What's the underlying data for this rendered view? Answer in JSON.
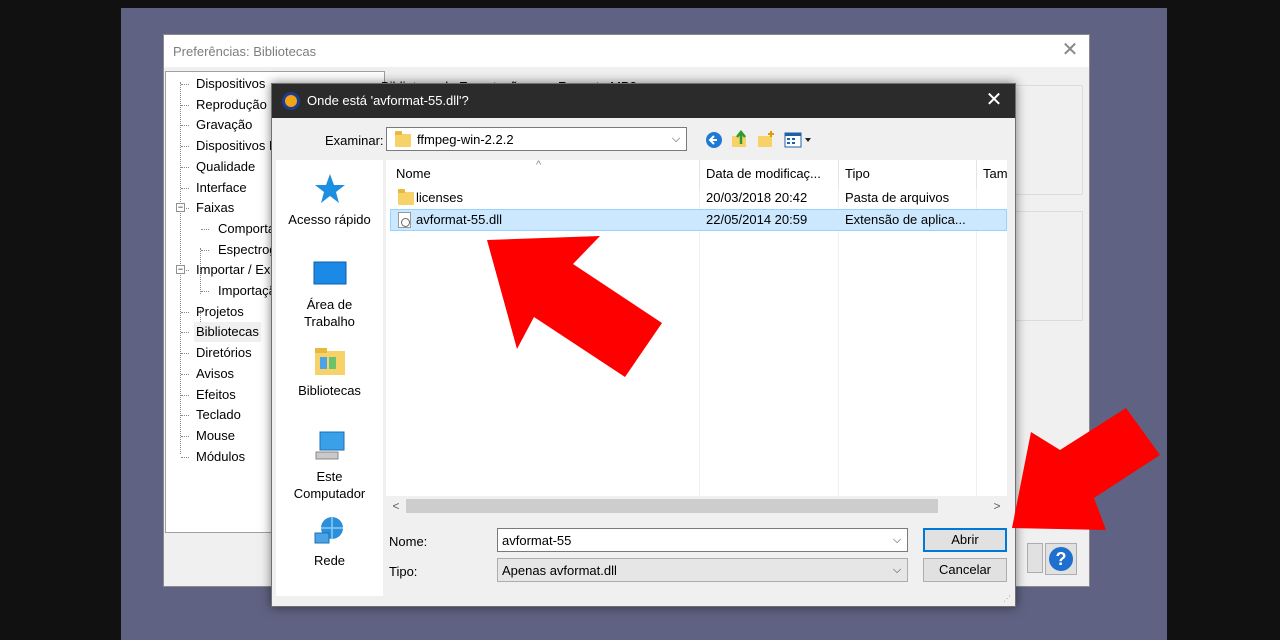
{
  "prefs": {
    "title": "Preferências: Bibliotecas",
    "group_heading_partial": "Biblioteca de Exportação para Formato MP3",
    "tree": [
      {
        "label": "Dispositivos",
        "level": 0
      },
      {
        "label": "Reprodução",
        "level": 0
      },
      {
        "label": "Gravação",
        "level": 0
      },
      {
        "label": "Dispositivos MIDI",
        "level": 0
      },
      {
        "label": "Qualidade",
        "level": 0
      },
      {
        "label": "Interface",
        "level": 0
      },
      {
        "label": "Faixas",
        "level": 0,
        "expanded": true
      },
      {
        "label": "Comportamento",
        "level": 1
      },
      {
        "label": "Espectrogramas",
        "level": 1
      },
      {
        "label": "Importar / Exportar",
        "level": 0,
        "expanded": true
      },
      {
        "label": "Importação",
        "level": 1
      },
      {
        "label": "Projetos",
        "level": 0
      },
      {
        "label": "Bibliotecas",
        "level": 0,
        "selected": true
      },
      {
        "label": "Diretórios",
        "level": 0
      },
      {
        "label": "Avisos",
        "level": 0
      },
      {
        "label": "Efeitos",
        "level": 0
      },
      {
        "label": "Teclado",
        "level": 0
      },
      {
        "label": "Mouse",
        "level": 0
      },
      {
        "label": "Módulos",
        "level": 0
      }
    ],
    "help_label": "?"
  },
  "dialog": {
    "title": "Onde está 'avformat-55.dll'?",
    "look_in_label": "Examinar:",
    "look_in_value": "ffmpeg-win-2.2.2",
    "places": [
      {
        "label": "Acesso rápido",
        "icon": "quick-access-star-icon"
      },
      {
        "label": "Área de Trabalho",
        "icon": "desktop-icon"
      },
      {
        "label": "Bibliotecas",
        "icon": "libraries-icon"
      },
      {
        "label": "Este Computador",
        "icon": "computer-icon"
      },
      {
        "label": "Rede",
        "icon": "network-icon"
      }
    ],
    "columns": [
      "Nome",
      "Data de modificaç...",
      "Tipo",
      "Tam"
    ],
    "files": [
      {
        "name": "licenses",
        "date": "20/03/2018 20:42",
        "type": "Pasta de arquivos",
        "icon": "folder-icon"
      },
      {
        "name": "avformat-55.dll",
        "date": "22/05/2014 20:59",
        "type": "Extensão de aplica...",
        "icon": "dll-file-icon",
        "selected": true
      }
    ],
    "name_label": "Nome:",
    "name_value": "avformat-55",
    "type_label": "Tipo:",
    "type_value": "Apenas avformat.dll",
    "open_label": "Abrir",
    "cancel_label": "Cancelar"
  },
  "colors": {
    "arrow": "#ff0000",
    "selection": "#cce8ff",
    "backdrop": "#5f6282",
    "title_bar_dark": "#2b2b2b"
  }
}
